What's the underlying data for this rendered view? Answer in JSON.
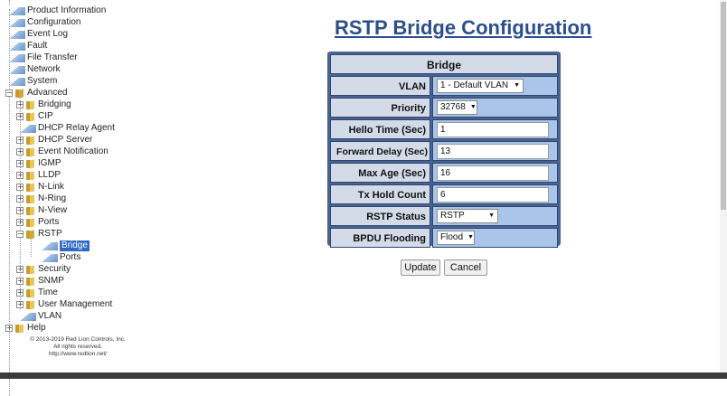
{
  "tree": {
    "top_items": [
      "Product Information",
      "Configuration",
      "Event Log",
      "Fault",
      "File Transfer",
      "Network",
      "System"
    ],
    "advanced": {
      "label": "Advanced",
      "children": [
        "Bridging",
        "CIP",
        "DHCP Relay Agent",
        "DHCP Server",
        "Event Notification",
        "IGMP",
        "LLDP",
        "N-Link",
        "N-Ring",
        "N-View",
        "Ports"
      ],
      "rstp": {
        "label": "RSTP",
        "children": [
          "Bridge",
          "Ports"
        ],
        "selected": "Bridge"
      },
      "after": [
        "Security",
        "SNMP",
        "Time",
        "User Management",
        "VLAN"
      ]
    },
    "help": "Help",
    "expand_glyph": "+",
    "collapse_glyph": "−"
  },
  "footer": {
    "line1": "© 2013-2019 Red Lion Controls, Inc.",
    "line2": "All rights reserved.",
    "line3": "http://www.redlion.net/"
  },
  "page_title": "RSTP Bridge Configuration",
  "bridge": {
    "header": "Bridge",
    "vlan": {
      "label": "VLAN",
      "value": "1 - Default VLAN"
    },
    "priority": {
      "label": "Priority",
      "value": "32768"
    },
    "hello_time": {
      "label": "Hello Time (Sec)",
      "value": "1"
    },
    "forward_delay": {
      "label": "Forward Delay (Sec)",
      "value": "13"
    },
    "max_age": {
      "label": "Max Age (Sec)",
      "value": "16"
    },
    "tx_hold_count": {
      "label": "Tx Hold Count",
      "value": "6"
    },
    "rstp_status": {
      "label": "RSTP Status",
      "value": "RSTP"
    },
    "bpdu_flooding": {
      "label": "BPDU Flooding",
      "value": "Flood"
    }
  },
  "buttons": {
    "update": "Update",
    "cancel": "Cancel"
  }
}
